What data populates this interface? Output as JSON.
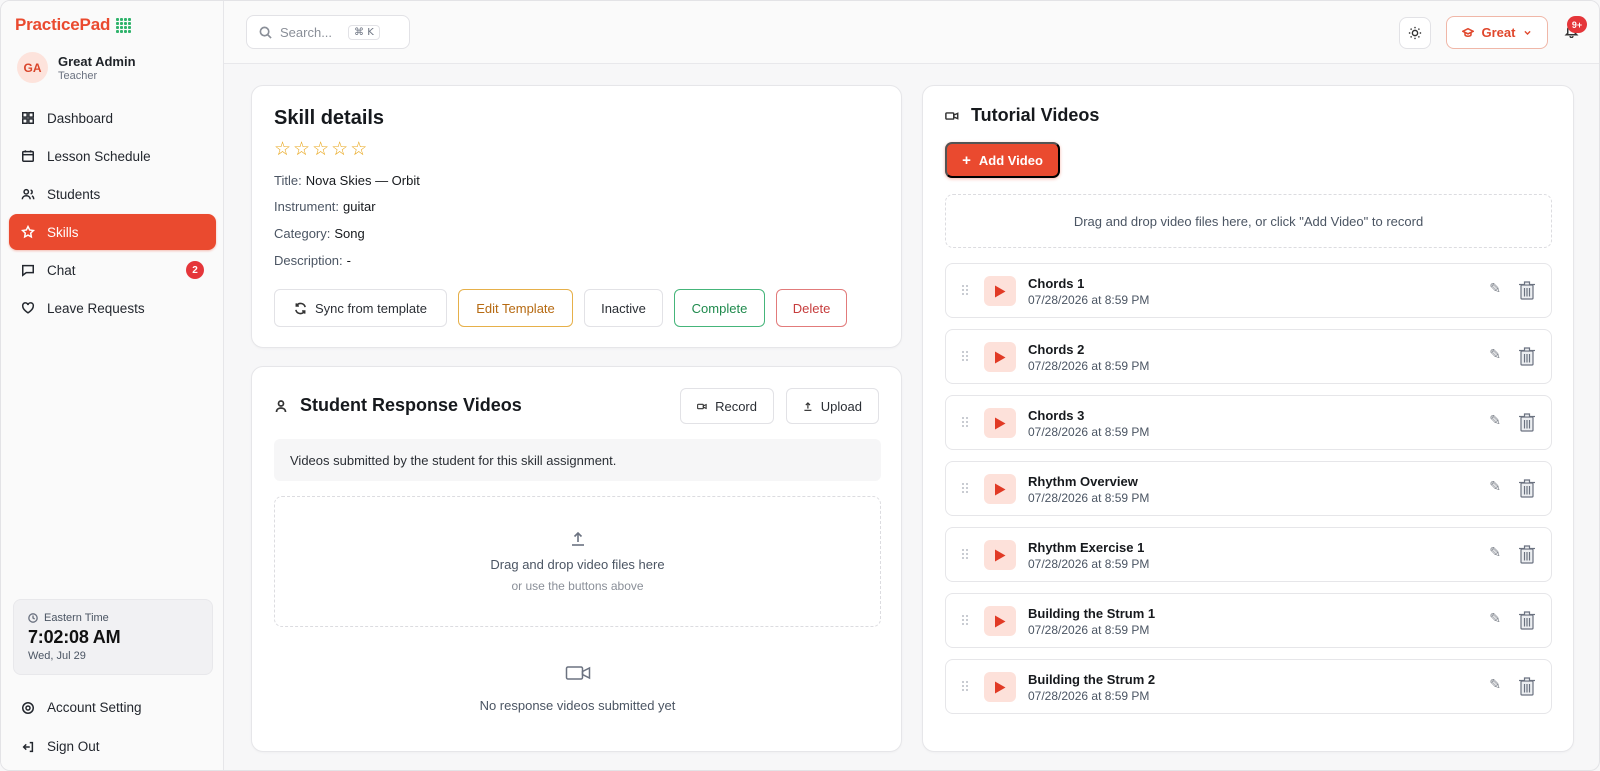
{
  "brand": {
    "name": "PracticePad"
  },
  "user": {
    "initials": "GA",
    "name": "Great Admin",
    "role": "Teacher"
  },
  "sidebar": {
    "items": [
      {
        "label": "Dashboard",
        "icon": "dashboard-icon"
      },
      {
        "label": "Lesson Schedule",
        "icon": "calendar-icon"
      },
      {
        "label": "Students",
        "icon": "users-icon"
      },
      {
        "label": "Skills",
        "icon": "star-icon",
        "active": true
      },
      {
        "label": "Chat",
        "icon": "chat-icon",
        "badge": "2"
      },
      {
        "label": "Leave Requests",
        "icon": "heart-icon"
      }
    ],
    "bottom": [
      {
        "label": "Account Setting",
        "icon": "settings-icon"
      },
      {
        "label": "Sign Out",
        "icon": "sign-out-icon"
      }
    ]
  },
  "clock": {
    "zone": "Eastern Time",
    "time": "7:02:08 AM",
    "date": "Wed, Jul 29"
  },
  "topbar": {
    "search_placeholder": "Search...",
    "shortcut": "⌘ K",
    "org_label": "Great",
    "notification_count": "9+"
  },
  "skill": {
    "heading": "Skill details",
    "rating": 0,
    "stars_total": 5,
    "fields": {
      "title_label": "Title:",
      "title_value": "Nova Skies — Orbit",
      "instrument_label": "Instrument:",
      "instrument_value": "guitar",
      "category_label": "Category:",
      "category_value": "Song",
      "description_label": "Description:",
      "description_value": "-"
    },
    "buttons": {
      "sync": "Sync from template",
      "edit": "Edit Template",
      "inactive": "Inactive",
      "complete": "Complete",
      "delete": "Delete"
    }
  },
  "responses": {
    "heading": "Student Response Videos",
    "record_label": "Record",
    "upload_label": "Upload",
    "info": "Videos submitted by the student for this skill assignment.",
    "drop_main": "Drag and drop video files here",
    "drop_sub": "or use the buttons above",
    "empty": "No response videos submitted yet"
  },
  "tutorials": {
    "heading": "Tutorial Videos",
    "add_label": "Add Video",
    "drop_text": "Drag and drop video files here, or click \"Add Video\" to record",
    "videos": [
      {
        "title": "Chords 1",
        "date": "07/28/2026 at 8:59 PM"
      },
      {
        "title": "Chords 2",
        "date": "07/28/2026 at 8:59 PM"
      },
      {
        "title": "Chords 3",
        "date": "07/28/2026 at 8:59 PM"
      },
      {
        "title": "Rhythm Overview",
        "date": "07/28/2026 at 8:59 PM"
      },
      {
        "title": "Rhythm Exercise 1",
        "date": "07/28/2026 at 8:59 PM"
      },
      {
        "title": "Building the Strum 1",
        "date": "07/28/2026 at 8:59 PM"
      },
      {
        "title": "Building the Strum 2",
        "date": "07/28/2026 at 8:59 PM"
      }
    ]
  },
  "colors": {
    "accent": "#ea4a2f",
    "badge": "#e5363a",
    "star": "#e8a416",
    "complete": "#1f8a4d",
    "delete": "#c63c3c",
    "edit": "#b66a12"
  }
}
